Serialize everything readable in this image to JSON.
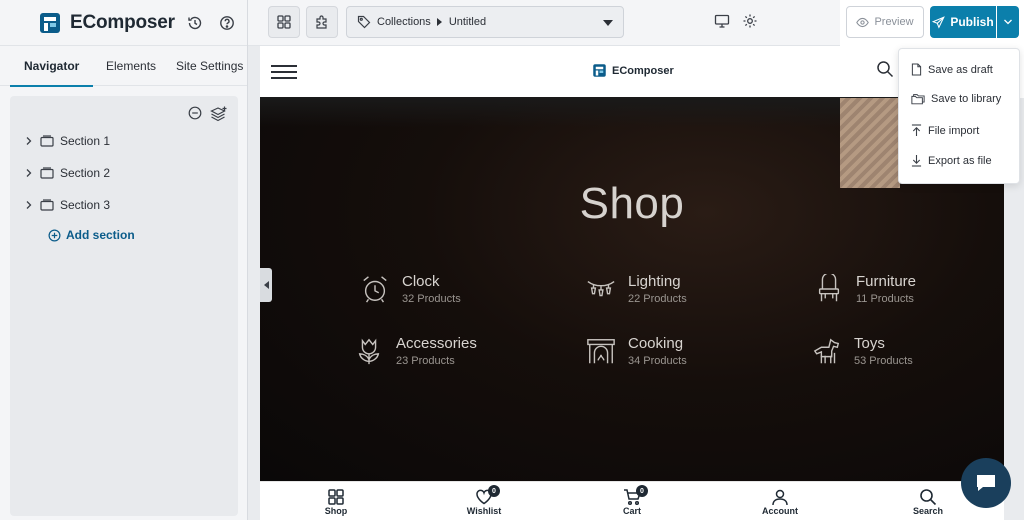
{
  "app": {
    "brand_name": "EComposer"
  },
  "left_panel": {
    "tabs": [
      {
        "label": "Navigator",
        "active": true
      },
      {
        "label": "Elements",
        "active": false
      },
      {
        "label": "Site Settings",
        "active": false
      }
    ],
    "sections": [
      {
        "label": "Section 1"
      },
      {
        "label": "Section 2"
      },
      {
        "label": "Section 3"
      }
    ],
    "add_section_label": "Add section"
  },
  "toolbar": {
    "breadcrumb_root": "Collections",
    "breadcrumb_page": "Untitled",
    "preview_label": "Preview",
    "publish_label": "Publish"
  },
  "publish_menu": {
    "items": [
      {
        "label": "Save as draft",
        "icon": "file-icon"
      },
      {
        "label": "Save to library",
        "icon": "folders-icon"
      },
      {
        "label": "File import",
        "icon": "upload-icon"
      },
      {
        "label": "Export as file",
        "icon": "download-icon"
      }
    ]
  },
  "site": {
    "logo_text": "EComposer",
    "hero_title": "Shop",
    "categories": [
      {
        "name": "Clock",
        "count": "32 Products",
        "icon": "alarm-clock-icon"
      },
      {
        "name": "Lighting",
        "count": "22 Products",
        "icon": "string-lights-icon"
      },
      {
        "name": "Furniture",
        "count": "11 Products",
        "icon": "chair-icon"
      },
      {
        "name": "Accessories",
        "count": "23 Products",
        "icon": "tulip-icon"
      },
      {
        "name": "Cooking",
        "count": "34 Products",
        "icon": "fireplace-icon"
      },
      {
        "name": "Toys",
        "count": "53 Products",
        "icon": "horse-icon"
      }
    ],
    "bottom_nav": [
      {
        "label": "Shop",
        "icon": "grid-icon"
      },
      {
        "label": "Wishlist",
        "icon": "heart-icon",
        "badge": "0"
      },
      {
        "label": "Cart",
        "icon": "cart-icon",
        "badge": "0"
      },
      {
        "label": "Account",
        "icon": "user-icon"
      },
      {
        "label": "Search",
        "icon": "search-icon"
      }
    ]
  },
  "colors": {
    "accent": "#0b7fab",
    "chat": "#1a3f5c"
  }
}
